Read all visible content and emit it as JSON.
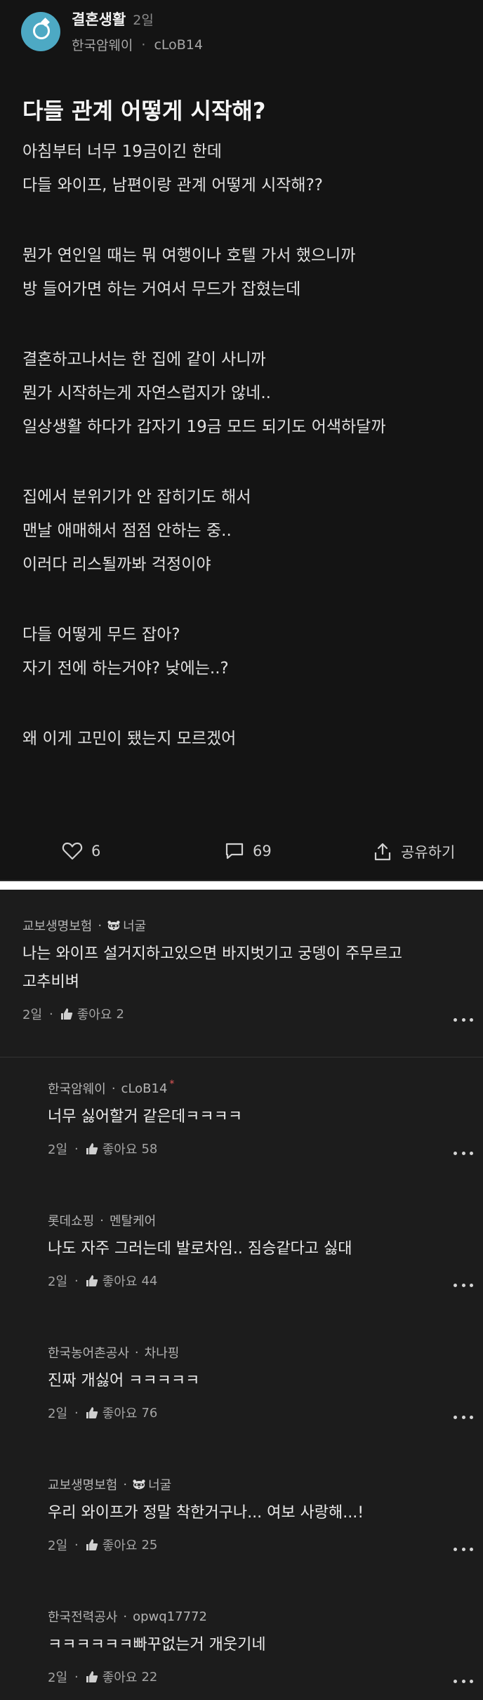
{
  "channel": {
    "name": "결혼생활",
    "time": "2일",
    "company": "한국암웨이",
    "nickname": "cLoB14"
  },
  "post": {
    "title": "다들 관계 어떻게 시작해?",
    "body": [
      "아침부터 너무 19금이긴 한데",
      "다들 와이프, 남편이랑 관계 어떻게 시작해??",
      "",
      "뭔가 연인일 때는 뭐 여행이나 호텔 가서 했으니까",
      "방 들어가면 하는 거여서 무드가 잡혔는데",
      "",
      "결혼하고나서는 한 집에 같이 사니까",
      "뭔가 시작하는게 자연스럽지가 않네..",
      "일상생활 하다가 갑자기 19금 모드 되기도 어색하달까",
      "",
      "집에서 분위기가 안 잡히기도 해서",
      "맨날 애매해서 점점 안하는 중..",
      "이러다 리스될까봐 걱정이야",
      "",
      "다들 어떻게 무드 잡아?",
      "자기 전에 하는거야? 낮에는..?",
      "",
      "왜 이게 고민이 됐는지 모르겠어"
    ],
    "likes": "6",
    "comments": "69",
    "share_label": "공유하기"
  },
  "comments": [
    {
      "company": "교보생명보험",
      "nickname": "너굴",
      "nick_icon": "raccoon-icon",
      "lines": [
        "나는 와이프 설거지하고있으면 바지벗기고 궁뎅이 주무르고",
        "고추비벼"
      ],
      "time": "2일",
      "like_label": "좋아요",
      "like_count": "2"
    },
    {
      "company": "한국암웨이",
      "nickname": "cLoB14",
      "is_author": true,
      "lines": [
        "너무 싫어할거 같은데ㅋㅋㅋㅋ"
      ],
      "time": "2일",
      "like_label": "좋아요",
      "like_count": "58"
    },
    {
      "company": "롯데쇼핑",
      "nickname": "멘탈케어",
      "lines": [
        "나도 자주 그러는데 발로차임.. 짐승같다고 싫대"
      ],
      "time": "2일",
      "like_label": "좋아요",
      "like_count": "44"
    },
    {
      "company": "한국농어촌공사",
      "nickname": "차나핑",
      "lines": [
        "진짜 개싫어 ㅋㅋㅋㅋㅋ"
      ],
      "time": "2일",
      "like_label": "좋아요",
      "like_count": "76"
    },
    {
      "company": "교보생명보험",
      "nickname": "너굴",
      "nick_icon": "raccoon-icon",
      "lines": [
        "우리 와이프가 정말 착한거구나... 여보 사랑해...!"
      ],
      "time": "2일",
      "like_label": "좋아요",
      "like_count": "25"
    },
    {
      "company": "한국전력공사",
      "nickname": "opwq17772",
      "lines": [
        "ㅋㅋㅋㅋㅋㅋ빠꾸없는거 개웃기네"
      ],
      "time": "2일",
      "like_label": "좋아요",
      "like_count": "22"
    }
  ],
  "colors": {
    "post_bg": "#141414",
    "comments_bg": "#1c1c1c",
    "channel_icon": "#4da9c4",
    "author_mark": "#e65a5a"
  }
}
